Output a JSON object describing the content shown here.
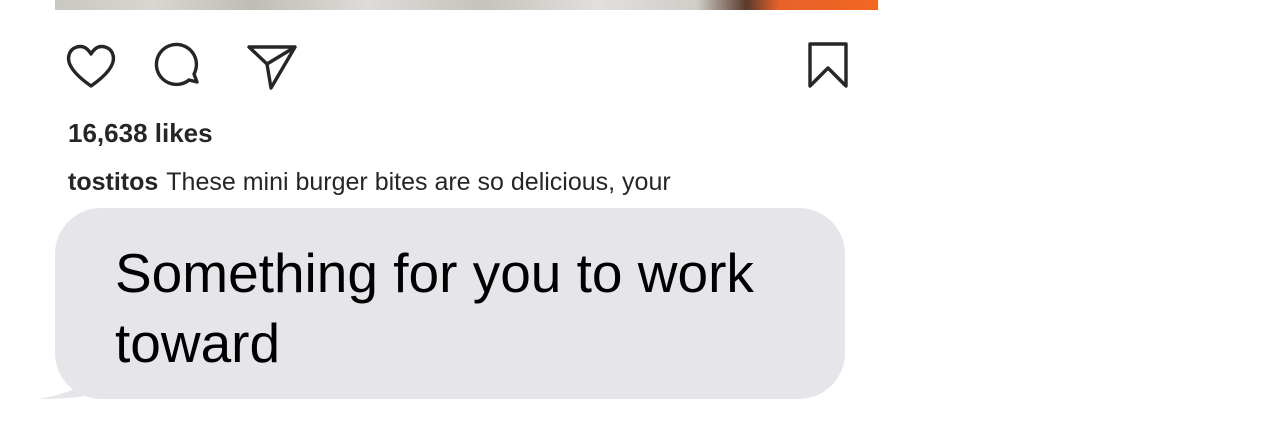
{
  "post": {
    "actions": {
      "like_icon": "heart-icon",
      "comment_icon": "comment-icon",
      "share_icon": "paper-plane-icon",
      "save_icon": "bookmark-icon"
    },
    "likes_text": "16,638 likes",
    "caption": {
      "username": "tostitos",
      "text": "These mini burger bites are so delicious, your"
    }
  },
  "message": {
    "text": "Something for you to work toward",
    "bubble_color": "#e5e5ea"
  }
}
